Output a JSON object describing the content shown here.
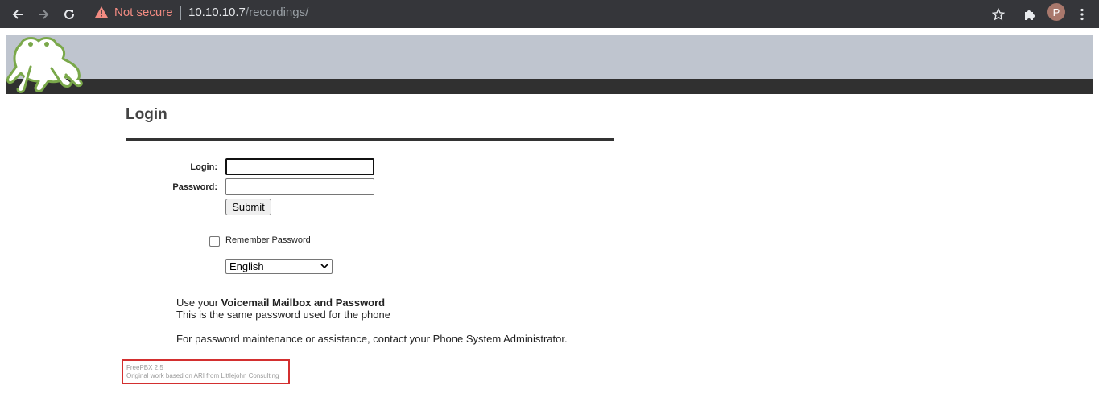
{
  "browser": {
    "security_label": "Not secure",
    "url_host": "10.10.10.7",
    "url_path": "/recordings/",
    "profile_initial": "P"
  },
  "login": {
    "title": "Login",
    "login_label": "Login:",
    "login_value": "",
    "password_label": "Password:",
    "password_value": "",
    "submit_label": "Submit",
    "remember_label": "Remember Password",
    "remember_checked": false,
    "language_selected": "English"
  },
  "info": {
    "line1_prefix": "Use your ",
    "line1_bold": "Voicemail Mailbox and Password",
    "line2": "This is the same password used for the phone",
    "line3": "For password maintenance or assistance, contact your Phone System Administrator."
  },
  "footer": {
    "version": "FreePBX 2.5",
    "credit": "Original work based on ARI from Littlejohn Consulting"
  },
  "colors": {
    "header_band": "#bfc5cf",
    "header_bar": "#303030",
    "footer_border": "#d32f2f",
    "logo_green": "#7aa84a"
  }
}
